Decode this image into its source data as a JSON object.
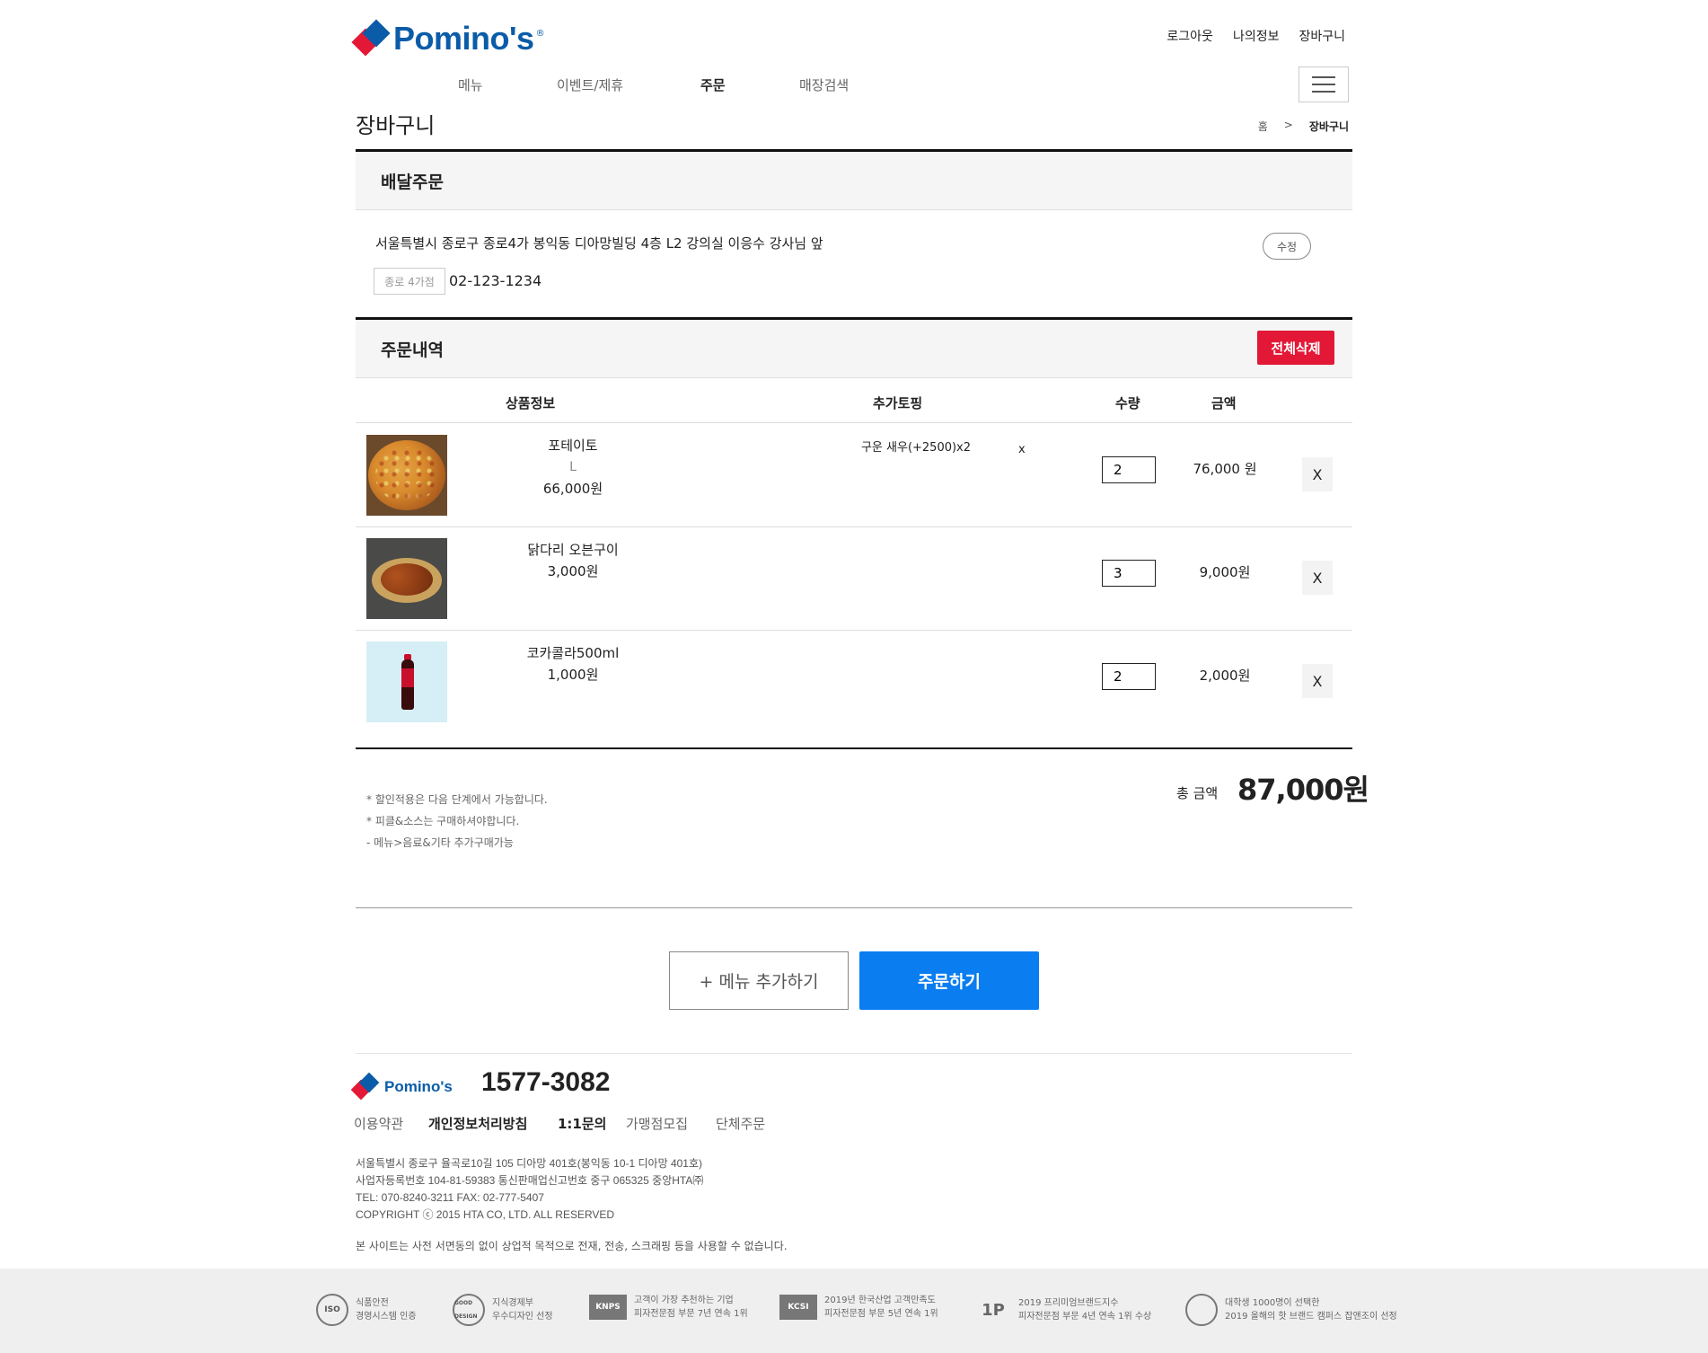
{
  "header": {
    "logo": "Pomino's",
    "logo_reg": "®",
    "top_links": [
      "로그아웃",
      "나의정보",
      "장바구니"
    ],
    "gnb": [
      "메뉴",
      "이벤트/제휴",
      "주문",
      "매장검색"
    ],
    "page_title": "장바구니",
    "breadcrumb": [
      "홈",
      ">",
      "장바구니"
    ]
  },
  "delivery": {
    "title": "배달주문",
    "address": "서울특별시 종로구 종로4가 봉익동 디아망빌딩 4층 L2 강의실 이응수 강사님 앞",
    "edit_label": "수정",
    "store": "종로 4가점",
    "phone": "02-123-1234"
  },
  "order": {
    "title": "주문내역",
    "delete_all": "전체삭제",
    "columns": [
      "상품정보",
      "추가토핑",
      "수량",
      "금액"
    ],
    "items": [
      {
        "name": "포테이토",
        "size": "L",
        "price": "66,000원",
        "topping": "구운 새우(+2500)x2",
        "topping_remove": "x",
        "qty": "2",
        "amount": "76,000 원",
        "remove": "X",
        "thumb": "pizza"
      },
      {
        "name": "닭다리 오븐구이",
        "price": "3,000원",
        "qty": "3",
        "amount": "9,000원",
        "remove": "X",
        "thumb": "chicken"
      },
      {
        "name": "코카콜라500ml",
        "price": "1,000원",
        "qty": "2",
        "amount": "2,000원",
        "remove": "X",
        "thumb": "coke"
      }
    ],
    "notes": [
      "* 할인적용은 다음 단계에서 가능합니다.",
      "* 피클&소스는 구매하셔야합니다.",
      "- 메뉴>음료&기타 추가구매가능"
    ],
    "total_label": "총 금액",
    "total_value": "87,000원"
  },
  "actions": {
    "add_menu": "+ 메뉴 추가하기",
    "checkout": "주문하기"
  },
  "footer": {
    "logo": "Pomino's",
    "phone": "1577-3082",
    "links": [
      "이용약관",
      "개인정보처리방침",
      "1:1문의",
      "가맹점모집",
      "단체주문"
    ],
    "info": [
      "서울특별시 종로구 율곡로10길 105 디아망 401호(봉익동 10-1 디아망 401호)",
      "사업자등록번호 104-81-59383 통신판매업신고번호 중구 065325 중앙HTA㈜",
      "TEL: 070-8240-3211 FAX: 02-777-5407",
      "COPYRIGHT ⓒ 2015 HTA CO, LTD. ALL RESERVED"
    ],
    "notice": "본 사이트는 사전 서면동의 없이 상업적 목적으로 전재, 전송, 스크래핑 등을 사용할 수 없습니다.",
    "certs": [
      {
        "icon": "ISO",
        "line1": "식품안전",
        "line2": "경영시스템 인증"
      },
      {
        "icon": "GOOD DESIGN",
        "line1": "지식경제부",
        "line2": "우수디자인 선정"
      },
      {
        "icon": "KNPS",
        "line1": "고객이 가장 추천하는 기업",
        "line2": "피자전문점 부문 7년 연속 1위"
      },
      {
        "icon": "KCSI",
        "line1": "2019년 한국산업 고객만족도",
        "line2": "피자전문점 부문 5년 연속 1위"
      },
      {
        "icon": "1P",
        "line1": "2019 프리미엄브랜드지수",
        "line2": "피자전문점 부문 4년 연속 1위 수상"
      },
      {
        "icon": "",
        "line1": "대학생 1000명이 선택한",
        "line2": "2019 올해의 핫 브랜드 캠퍼스 잡앤조이 선정"
      }
    ]
  },
  "colors": {
    "brand_blue": "#0b5ca8",
    "brand_red": "#e31837",
    "order_button": "#0a7df0"
  }
}
